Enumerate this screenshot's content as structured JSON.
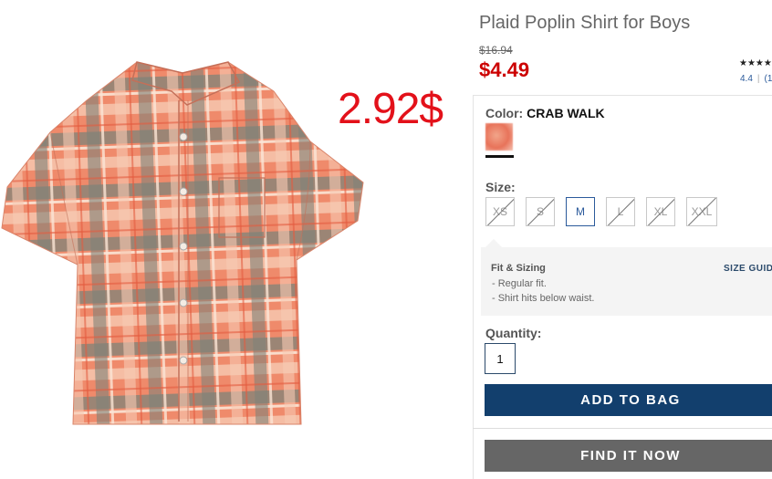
{
  "product": {
    "title": "Plaid Poplin Shirt for Boys",
    "original_price": "$16.94",
    "sale_price": "$4.49",
    "overlay_price": "2.92$",
    "stars": "★★★★",
    "rating_value": "4.4",
    "rating_count": "(1"
  },
  "color": {
    "label": "Color:",
    "value": "CRAB WALK",
    "swatch_color": "#e8735a"
  },
  "size": {
    "label": "Size:",
    "options": [
      {
        "label": "XS",
        "available": false
      },
      {
        "label": "S",
        "available": false
      },
      {
        "label": "M",
        "available": true,
        "selected": true
      },
      {
        "label": "L",
        "available": false
      },
      {
        "label": "XL",
        "available": false
      },
      {
        "label": "XXL",
        "available": false
      }
    ]
  },
  "fit": {
    "title": "Fit & Sizing",
    "size_guide": "SIZE GUID",
    "lines": [
      "-  Regular fit.",
      "-  Shirt hits below waist."
    ]
  },
  "quantity": {
    "label": "Quantity:",
    "value": "1"
  },
  "actions": {
    "add_to_bag": "ADD TO BAG",
    "find_it_now": "FIND IT NOW"
  },
  "colors": {
    "sale_red": "#cc0000",
    "overlay_red": "#e3111a",
    "primary_navy": "#123f6d",
    "secondary_gray": "#666666"
  }
}
